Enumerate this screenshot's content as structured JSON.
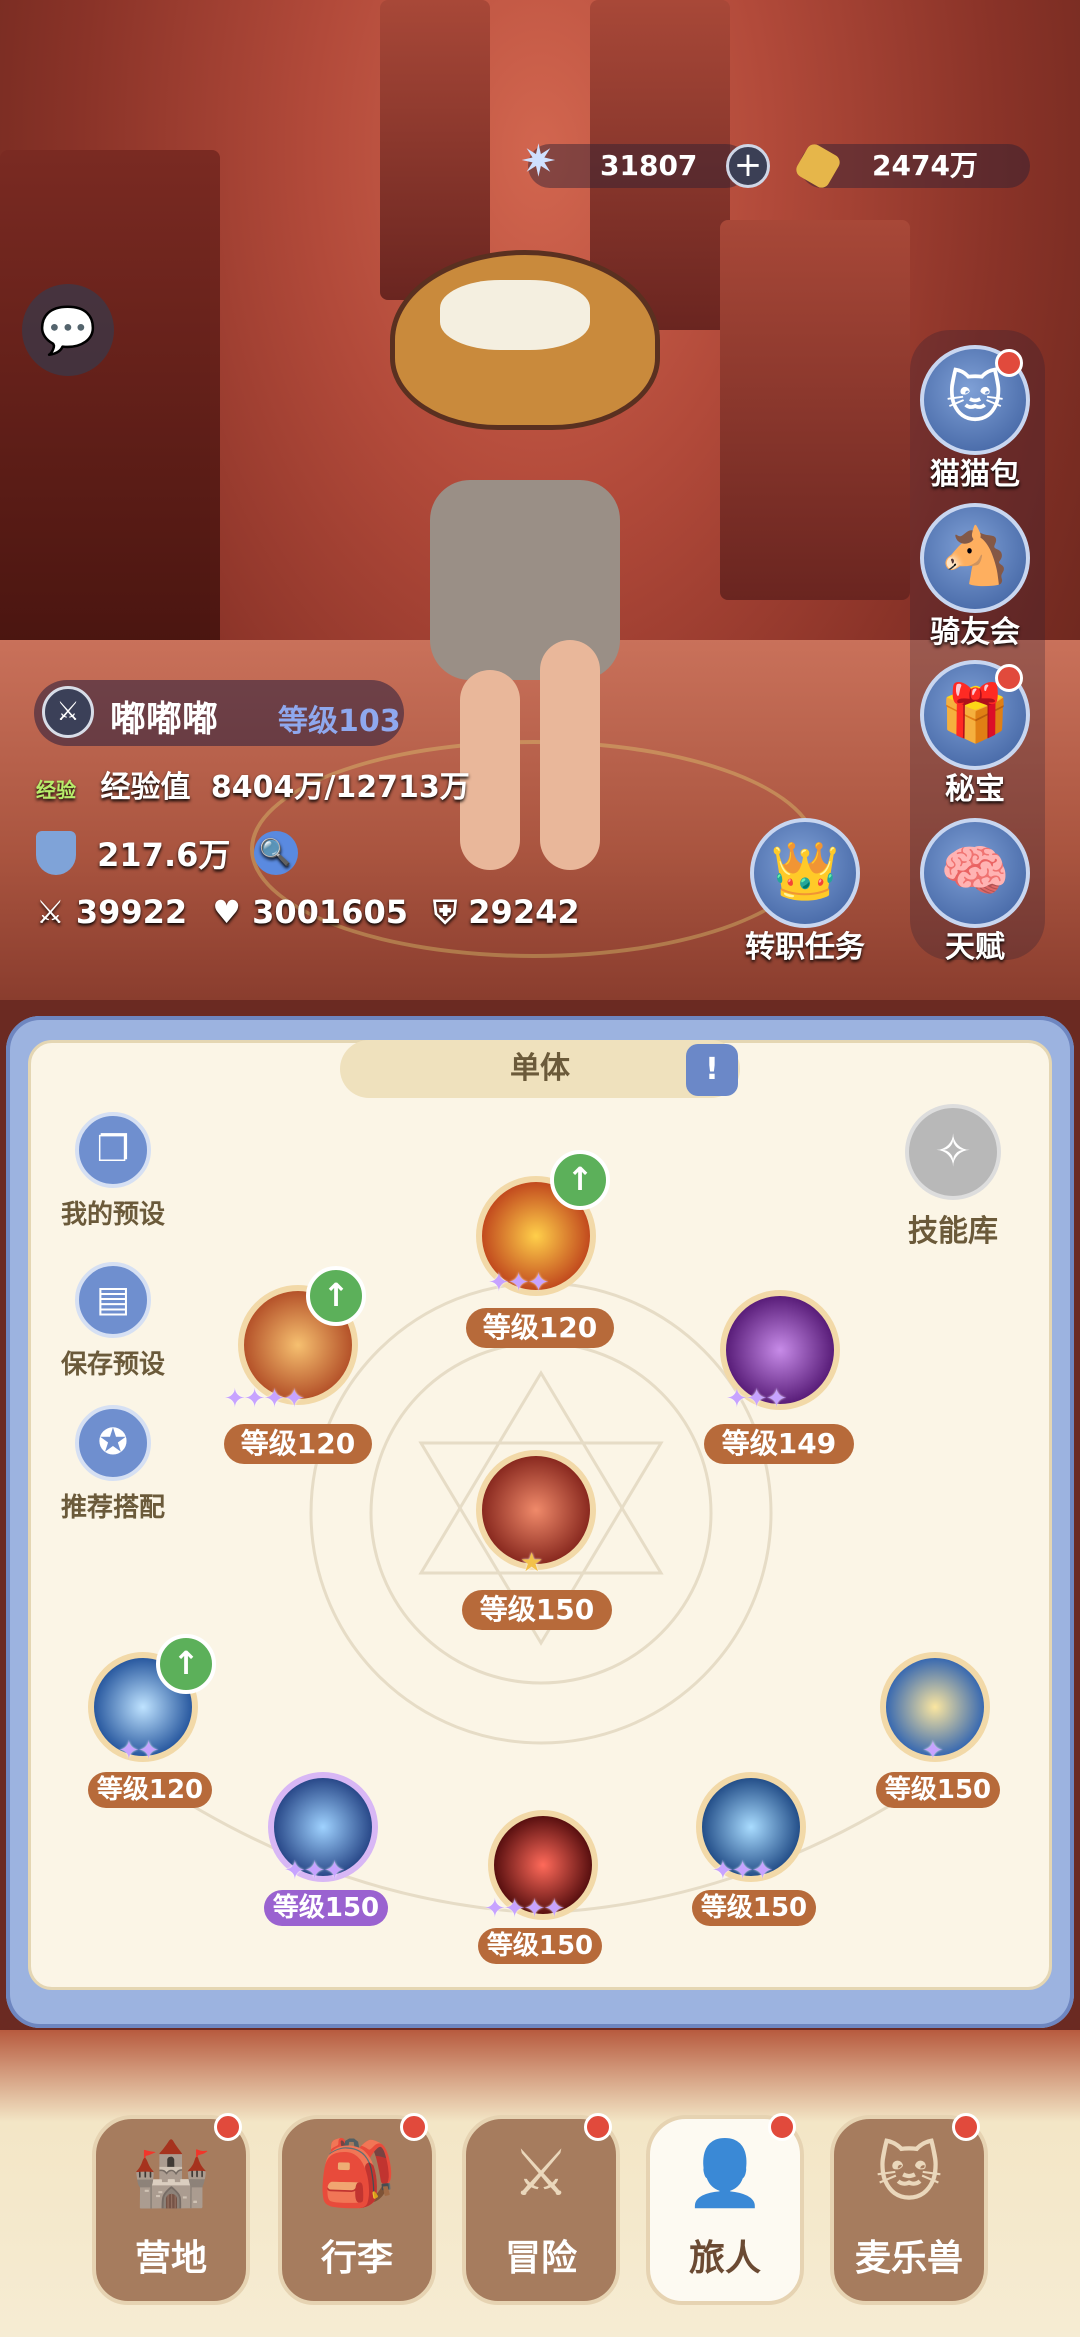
{
  "currency": {
    "gems": "31807",
    "gold": "2474万"
  },
  "side_menu": [
    {
      "label": "猫猫包",
      "icon": "cat-bag-icon",
      "badge": true
    },
    {
      "label": "骑友会",
      "icon": "horse-icon",
      "badge": false
    },
    {
      "label": "秘宝",
      "icon": "treasure-icon",
      "badge": true
    }
  ],
  "quest_buttons": [
    {
      "label": "转职任务",
      "icon": "crown-icon"
    },
    {
      "label": "天赋",
      "icon": "head-gear-icon"
    }
  ],
  "player": {
    "name": "嘟嘟嘟",
    "level": "等级103",
    "exp_tag": "经验",
    "exp_label": "经验值",
    "exp_value": "8404万/12713万",
    "power": "217.6万",
    "attack": "39922",
    "hp": "3001605",
    "defense": "29242"
  },
  "skills_panel": {
    "mode": "单体",
    "left_buttons": [
      "我的预设",
      "保存预设",
      "推荐搭配"
    ],
    "library": "技能库",
    "skills": [
      {
        "level": "等级120",
        "stars": "✦✦✦",
        "upgrade": true
      },
      {
        "level": "等级120",
        "stars": "✦✦✦✦",
        "upgrade": true
      },
      {
        "level": "等级149",
        "stars": "✦✦✦",
        "upgrade": false
      },
      {
        "level": "等级150",
        "stars": "★",
        "upgrade": false
      },
      {
        "level": "等级120",
        "stars": "✦✦",
        "upgrade": true
      },
      {
        "level": "等级150",
        "stars": "✦✦✦",
        "upgrade": false
      },
      {
        "level": "等级150",
        "stars": "✦✦✦✦",
        "upgrade": false
      },
      {
        "level": "等级150",
        "stars": "✦✦✦",
        "upgrade": false
      },
      {
        "level": "等级150",
        "stars": "✦",
        "upgrade": false
      }
    ]
  },
  "bottom_nav": [
    {
      "label": "营地",
      "badge": true
    },
    {
      "label": "行李",
      "badge": true
    },
    {
      "label": "冒险",
      "badge": true
    },
    {
      "label": "旅人",
      "badge": true,
      "active": true
    },
    {
      "label": "麦乐兽",
      "badge": true
    }
  ]
}
